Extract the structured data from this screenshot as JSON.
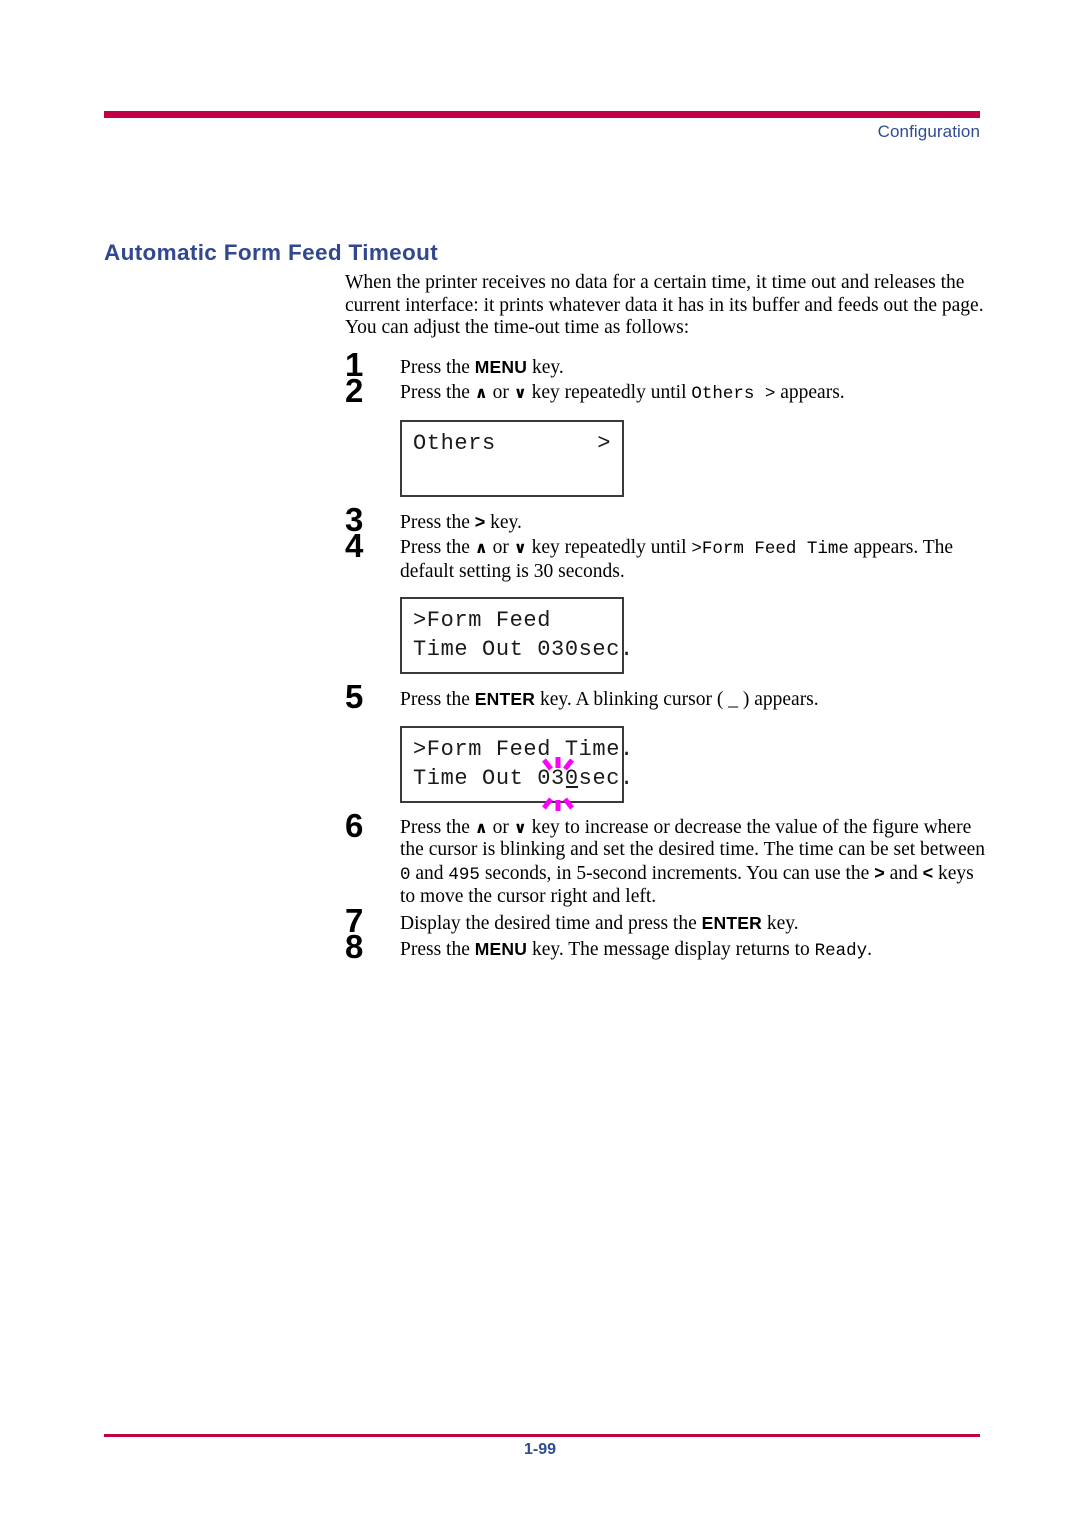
{
  "page": {
    "running_header": "Configuration",
    "section_title": "Automatic Form Feed Timeout",
    "footer_page_number": "1-99",
    "accent_rule_color": "#c10046",
    "heading_color": "#31488f",
    "blink_marker_color": "#ff00ff"
  },
  "intro": {
    "line1": "When the printer receives no data for a certain time, it time out and",
    "line2": "releases the current interface: it prints whatever data it has in its buffer",
    "line3": "and feeds out the page. You can adjust the time-out time as follows:"
  },
  "steps": [
    {
      "number": "1",
      "parts": [
        {
          "type": "text",
          "value": "Press the "
        },
        {
          "type": "key",
          "value": "MENU"
        },
        {
          "type": "text",
          "value": " key."
        }
      ]
    },
    {
      "number": "2",
      "parts": [
        {
          "type": "text",
          "value": "Press the "
        },
        {
          "type": "arrow",
          "value": "∧"
        },
        {
          "type": "text",
          "value": " or "
        },
        {
          "type": "arrow",
          "value": "∨"
        },
        {
          "type": "text",
          "value": " key repeatedly until "
        },
        {
          "type": "mono",
          "value": "Others  >"
        },
        {
          "type": "text",
          "value": " appears."
        }
      ]
    },
    {
      "number": "3",
      "parts": [
        {
          "type": "text",
          "value": "Press the "
        },
        {
          "type": "gt",
          "value": ">"
        },
        {
          "type": "text",
          "value": " key."
        }
      ]
    },
    {
      "number": "4",
      "parts": [
        {
          "type": "text",
          "value": "Press the "
        },
        {
          "type": "arrow",
          "value": "∧"
        },
        {
          "type": "text",
          "value": " or "
        },
        {
          "type": "arrow",
          "value": "∨"
        },
        {
          "type": "text",
          "value": " key repeatedly until "
        },
        {
          "type": "mono",
          "value": ">Form Feed Time"
        },
        {
          "type": "text",
          "value": " appears. The default setting is 30 seconds."
        }
      ]
    },
    {
      "number": "5",
      "parts": [
        {
          "type": "text",
          "value": "Press the "
        },
        {
          "type": "key",
          "value": "ENTER"
        },
        {
          "type": "text",
          "value": " key. A blinking cursor ( _ ) appears."
        }
      ]
    },
    {
      "number": "6",
      "parts": [
        {
          "type": "text",
          "value": "Press the "
        },
        {
          "type": "arrow",
          "value": "∧"
        },
        {
          "type": "text",
          "value": " or "
        },
        {
          "type": "arrow",
          "value": "∨"
        },
        {
          "type": "text",
          "value": " key to increase or decrease the value of the figure where the cursor is blinking and set the desired time. The time can be set between "
        },
        {
          "type": "mono",
          "value": "0"
        },
        {
          "type": "text",
          "value": " and "
        },
        {
          "type": "mono",
          "value": "495"
        },
        {
          "type": "text",
          "value": " seconds, in 5-second increments. You can use the "
        },
        {
          "type": "gt",
          "value": ">"
        },
        {
          "type": "text",
          "value": " and "
        },
        {
          "type": "gt",
          "value": "<"
        },
        {
          "type": "text",
          "value": " keys to move the cursor right and left."
        }
      ]
    },
    {
      "number": "7",
      "parts": [
        {
          "type": "text",
          "value": "Display the desired time and press the "
        },
        {
          "type": "key",
          "value": "ENTER"
        },
        {
          "type": "text",
          "value": " key."
        }
      ]
    },
    {
      "number": "8",
      "parts": [
        {
          "type": "text",
          "value": "Press the "
        },
        {
          "type": "key",
          "value": "MENU"
        },
        {
          "type": "text",
          "value": " key. The message display returns to "
        },
        {
          "type": "mono",
          "value": "Ready"
        },
        {
          "type": "text",
          "value": "."
        }
      ]
    }
  ],
  "lcd_panels": [
    {
      "id": "others",
      "line1_left": "Others",
      "line1_right": ">",
      "line2": "",
      "has_blink_marker": false
    },
    {
      "id": "form-feed-timeout",
      "line1": ">Form Feed",
      "line2": "Time Out 030sec.",
      "has_blink_marker": false
    },
    {
      "id": "form-feed-timeout-cursor",
      "line1": ">Form Feed Time.",
      "line2_pre": "Time Out 03",
      "line2_cursor_char": "0",
      "line2_post": "sec.",
      "has_blink_marker": true
    }
  ]
}
